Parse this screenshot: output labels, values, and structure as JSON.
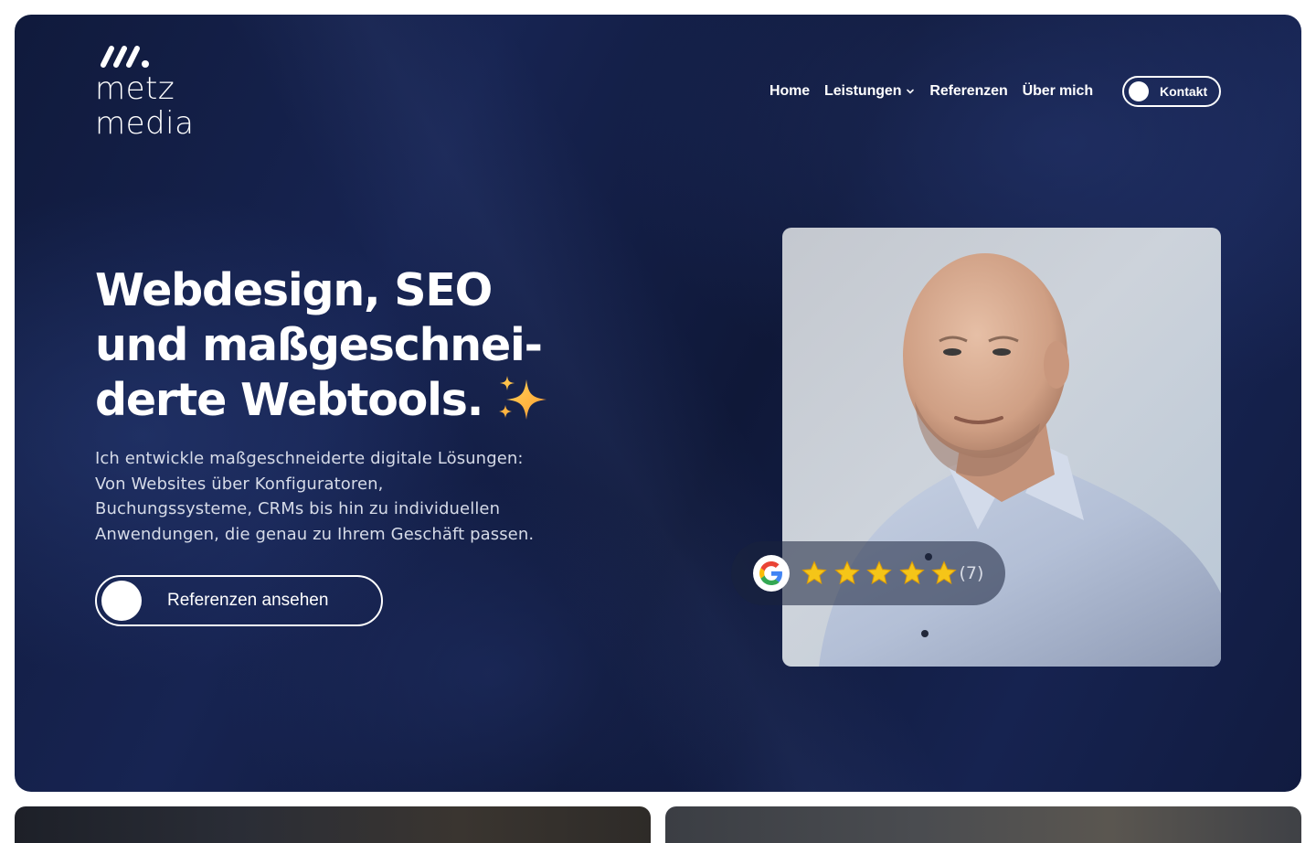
{
  "logo": {
    "line1": "metz",
    "line2": "media",
    "mark_icon": "metz-media-slashes-logo"
  },
  "nav": {
    "items": [
      {
        "label": "Home"
      },
      {
        "label": "Leistungen",
        "has_dropdown": true
      },
      {
        "label": "Referenzen"
      },
      {
        "label": "Über mich"
      }
    ],
    "cta_label": "Kontakt"
  },
  "hero": {
    "headline_lines": [
      "Webdesign, SEO",
      "und maßgeschnei-",
      "derte Webtools."
    ],
    "headline_icon": "sparkles-emoji",
    "lead_lines": [
      "Ich entwickle maßgeschneiderte digitale Lösungen:",
      "Von Websites über Konfiguratoren,",
      "Buchungssysteme, CRMs bis hin zu individuellen",
      "Anwendungen, die genau zu Ihrem Geschäft passen."
    ],
    "cta_label": "Referenzen ansehen"
  },
  "rating": {
    "provider_icon": "google-logo-icon",
    "stars": 5,
    "max_stars": 5,
    "count_text": "(7)"
  },
  "colors": {
    "hero_bg": "#141f48",
    "text": "#ffffff",
    "lead_text": "#d6dbe8",
    "star": "#f5c518"
  }
}
